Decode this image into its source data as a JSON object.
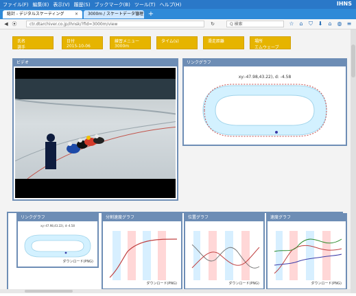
{
  "menu": [
    "ファイル(F)",
    "編集(E)",
    "表示(V)",
    "履歴(S)",
    "ブックマーク(B)",
    "ツール(T)",
    "ヘルプ(H)"
  ],
  "brand": "IHNS",
  "tabs": [
    {
      "label": "総計 - デジタルスケーティング"
    },
    {
      "label": "3000m / スケートデータ管理"
    }
  ],
  "nav": {
    "url": "ctr.dtarchiver.co.jp/ihnsk/?fid=3000m/view",
    "search_placeholder": "Q 検索"
  },
  "cards": [
    {
      "label": "氏名",
      "value": "選手"
    },
    {
      "label": "日付",
      "value": "2015-10-06"
    },
    {
      "label": "練習メニュー",
      "value": "3000m"
    },
    {
      "label": "タイム(s)",
      "value": ""
    },
    {
      "label": "滑走距離",
      "value": ""
    },
    {
      "label": "場所",
      "value": "エムウェーブ"
    }
  ],
  "panels": {
    "video": {
      "title": "ビデオ"
    },
    "rink_big": {
      "title": "リンクグラフ",
      "coords": "xy:-47.98,43.22), d: -4.58"
    },
    "rink_small": {
      "title": "リンクグラフ",
      "coords": "xy:-47.98,43.22), d:-4.58",
      "download": "ダウンロード(PNG)"
    },
    "speed_split": {
      "title": "分割速度グラフ",
      "download": "ダウンロード(PNG)"
    },
    "position": {
      "title": "位置グラフ",
      "download": "ダウンロード(PNG)"
    },
    "speed": {
      "title": "速度グラフ",
      "download": "ダウンロード(PNG)"
    }
  }
}
